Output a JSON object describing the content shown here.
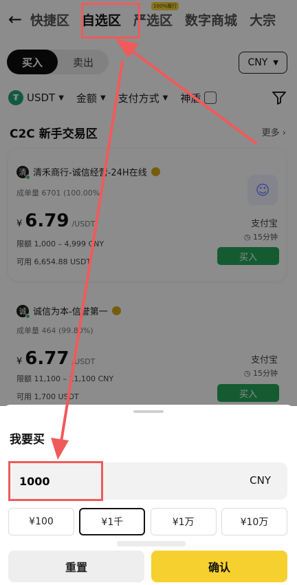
{
  "nav": {
    "tabs": [
      {
        "label": "快捷区"
      },
      {
        "label": "自选区"
      },
      {
        "label": "严选区",
        "badge": "100%履行"
      },
      {
        "label": "数字商城"
      },
      {
        "label": "大宗"
      }
    ],
    "active_tab": "自选区"
  },
  "trade": {
    "buy_label": "买入",
    "sell_label": "卖出",
    "currency": "CNY"
  },
  "filters": {
    "coin": "USDT",
    "amount": "金额",
    "payment": "支付方式",
    "shield": "神盾"
  },
  "section": {
    "title": "C2C 新手交易区",
    "more": "更多"
  },
  "listings": [
    {
      "avatar_char": "清",
      "merchant": "清禾商行-诚信经营-24H在线",
      "orders": "成单量 6701 (100.00%)",
      "currency_symbol": "¥",
      "price": "6.79",
      "price_unit": "/USDT",
      "limit": "限额 1,000 – 4,999 CNY",
      "available": "可用 6,654.88 USDT",
      "payment": "支付宝",
      "time": "15分钟",
      "button": "买入"
    },
    {
      "avatar_char": "诚",
      "merchant": "诚信为本-信誉第一",
      "orders": "成单量 464 (99.80%)",
      "currency_symbol": "¥",
      "price": "6.77",
      "price_unit": "/USDT",
      "limit": "限额 11,100 – 11,100 CNY",
      "available": "可用 1,700 USDT",
      "payment": "支付宝",
      "time": "15分钟",
      "button": "买入"
    }
  ],
  "sheet": {
    "title": "我要买",
    "amount_value": "1000",
    "amount_unit": "CNY",
    "quick_amounts": [
      "¥100",
      "¥1千",
      "¥1万",
      "¥10万"
    ],
    "quick_selected": "¥1千",
    "reset_label": "重置",
    "confirm_label": "确认"
  },
  "colors": {
    "accent_yellow": "#f6d02f",
    "buy_green": "#26a65b",
    "annotation_red": "#f05a5a"
  }
}
